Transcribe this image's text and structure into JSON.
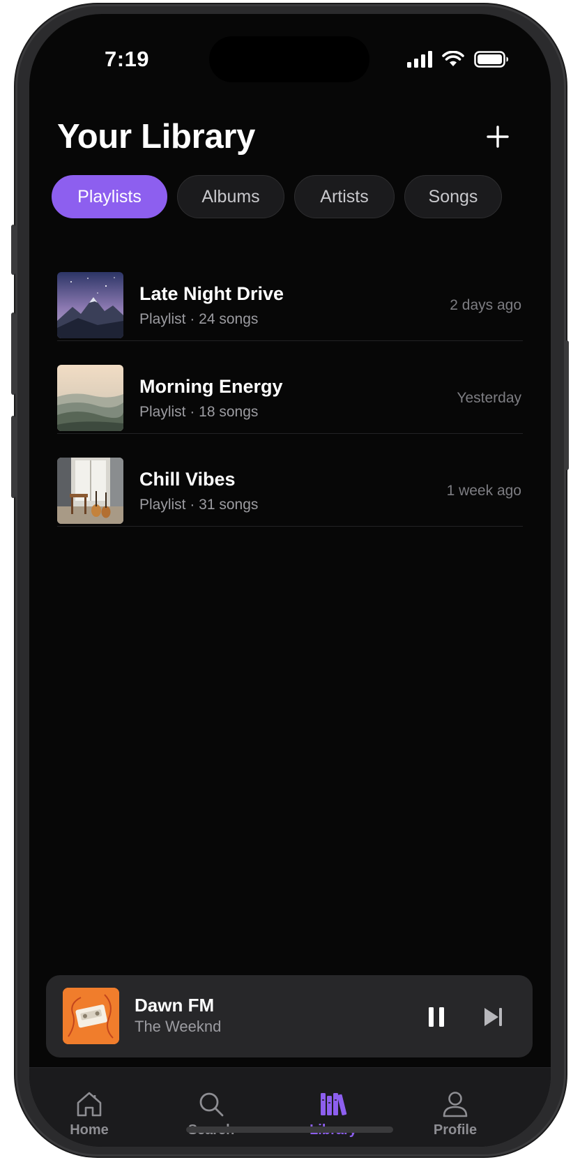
{
  "status_bar": {
    "time": "7:19"
  },
  "header": {
    "title": "Your Library"
  },
  "filters": [
    {
      "label": "Playlists",
      "active": true
    },
    {
      "label": "Albums",
      "active": false
    },
    {
      "label": "Artists",
      "active": false
    },
    {
      "label": "Songs",
      "active": false
    }
  ],
  "playlists": [
    {
      "title": "Late Night Drive",
      "subtitle": "Playlist · 24 songs",
      "updated": "2 days ago",
      "art": "mountain-night-art"
    },
    {
      "title": "Morning Energy",
      "subtitle": "Playlist · 18 songs",
      "updated": "Yesterday",
      "art": "misty-hills-art"
    },
    {
      "title": "Chill Vibes",
      "subtitle": "Playlist · 31 songs",
      "updated": "1 week ago",
      "art": "guitar-room-art"
    }
  ],
  "now_playing": {
    "title": "Dawn FM",
    "artist": "The Weeknd",
    "state": "playing"
  },
  "tabs": [
    {
      "label": "Home",
      "icon": "home-icon",
      "active": false
    },
    {
      "label": "Search",
      "icon": "search-icon",
      "active": false
    },
    {
      "label": "Library",
      "icon": "library-icon",
      "active": true
    },
    {
      "label": "Profile",
      "icon": "profile-icon",
      "active": false
    }
  ],
  "colors": {
    "accent": "#8d5fef",
    "background": "#070707",
    "surface": "#272729"
  }
}
